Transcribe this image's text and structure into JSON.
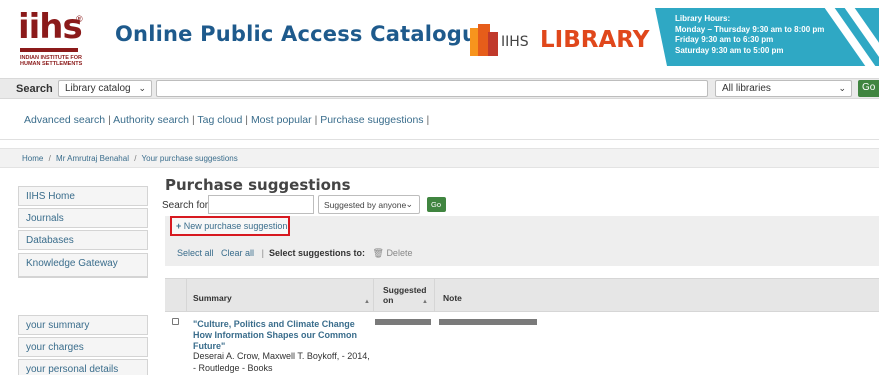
{
  "header": {
    "logo_text": "iihs",
    "logo_sub": "INDIAN INSTITUTE FOR HUMAN SETTLEMENTS",
    "title": "Online Public Access Catalogue",
    "library_logo_prefix": "IIHS",
    "library_logo_word": "LIBRARY",
    "hours": {
      "heading": "Library Hours:",
      "line1": "Monday – Thursday 9:30 am to 8:00 pm",
      "line2": "Friday 9:30 am to 6:30 pm",
      "line3": "Saturday 9:30 am to 5:00 pm"
    }
  },
  "search": {
    "label": "Search",
    "catalog_select": "Library catalog",
    "query": "",
    "libraries_select": "All libraries",
    "go_label": "Go"
  },
  "links": {
    "items": [
      "Advanced search",
      "Authority search",
      "Tag cloud",
      "Most popular",
      "Purchase suggestions"
    ],
    "separator": "|"
  },
  "breadcrumb": {
    "items": [
      "Home",
      "Mr Amrutraj Benahal",
      "Your purchase suggestions"
    ],
    "separator": "/"
  },
  "sidebar": {
    "top_items": [
      "IIHS Home",
      "Journals",
      "Databases",
      "Knowledge Gateway"
    ],
    "user_items": [
      "your summary",
      "your charges",
      "your personal details"
    ]
  },
  "main": {
    "title": "Purchase suggestions",
    "search_for_label": "Search for:",
    "search_for_value": "",
    "filter_select": "Suggested by anyone",
    "go_label": "Go",
    "new_suggestion_label": "New purchase suggestion",
    "select_all": "Select all",
    "clear_all": "Clear all",
    "separator": "|",
    "select_to_label": "Select suggestions to:",
    "delete_label": "Delete"
  },
  "table": {
    "columns": [
      "Summary",
      "Suggested on",
      "Note"
    ],
    "rows": [
      {
        "title": "\"Culture, Politics and Climate Change How Information Shapes our Common Future\"",
        "details": "Deserai A. Crow, Maxwell T. Boykoff, - 2014, - Routledge - Books"
      }
    ]
  }
}
